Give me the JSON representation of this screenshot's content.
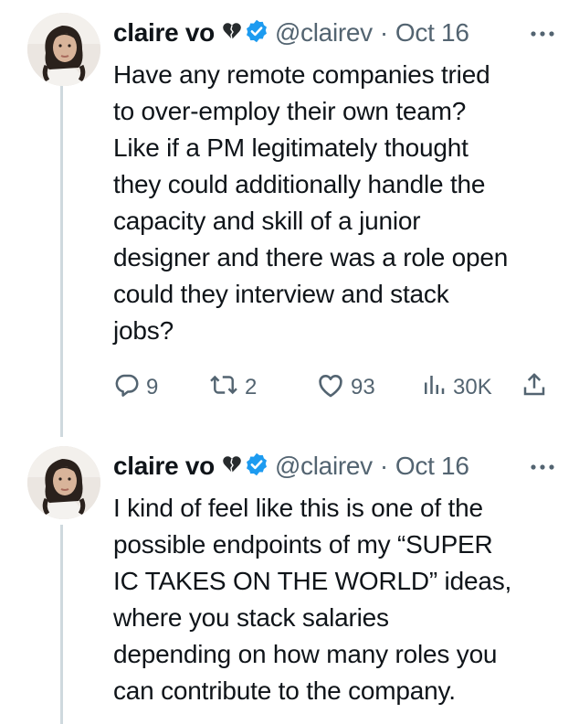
{
  "tweets": [
    {
      "name": "claire vo",
      "handle": "@clairev",
      "sep": "·",
      "date": "Oct 16",
      "lines": [
        "Have any remote companies tried",
        "to over-employ their own team?",
        "Like if a PM legitimately thought",
        "they could additionally handle the",
        "capacity and skill of a junior",
        "designer and there was a role open",
        "could they interview and stack",
        "jobs?"
      ],
      "actions": {
        "replies": "9",
        "reposts": "2",
        "likes": "93",
        "views": "30K"
      }
    },
    {
      "name": "claire vo",
      "handle": "@clairev",
      "sep": "·",
      "date": "Oct 16",
      "lines": [
        "I kind of feel like this is one of the",
        "possible endpoints of my “SUPER",
        "IC TAKES ON THE WORLD” ideas,",
        "where you stack salaries",
        "depending on how many roles you",
        "can contribute to the company."
      ]
    }
  ],
  "colors": {
    "text": "#0f1419",
    "secondary": "#536471",
    "verified": "#1d9bf0",
    "thread_line": "#cfd9de"
  },
  "icons": [
    "black-heart-icon",
    "verified-badge-icon",
    "more-icon",
    "reply-icon",
    "repost-icon",
    "like-icon",
    "views-icon",
    "share-icon"
  ]
}
